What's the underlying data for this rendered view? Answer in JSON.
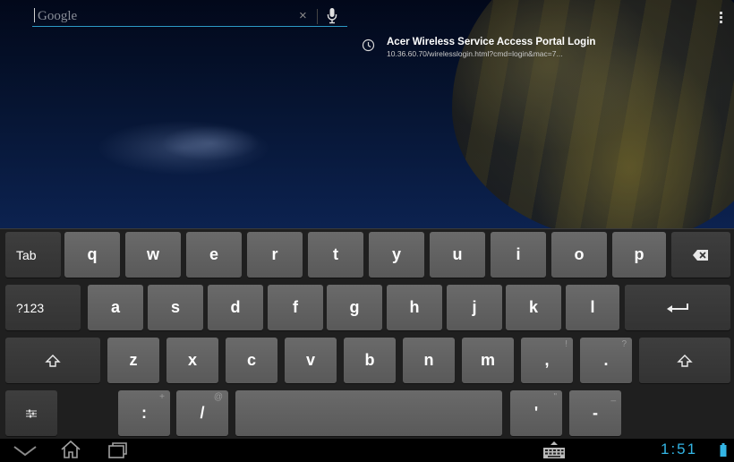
{
  "search": {
    "placeholder": "Google",
    "clear_icon": "×",
    "mic_icon": "microphone-icon"
  },
  "suggestion": {
    "icon": "history-clock-icon",
    "title": "Acer Wireless Service Access Portal Login",
    "url": "10.36.60.70/wirelesslogin.html?cmd=login&mac=7..."
  },
  "keyboard": {
    "row1": {
      "tab": "Tab",
      "keys": [
        "q",
        "w",
        "e",
        "r",
        "t",
        "y",
        "u",
        "i",
        "o",
        "p"
      ],
      "backspace_icon": "backspace-icon"
    },
    "row2": {
      "symbols": "?123",
      "keys": [
        "a",
        "s",
        "d",
        "f",
        "g",
        "h",
        "j",
        "k",
        "l"
      ],
      "enter_icon": "enter-arrow-icon"
    },
    "row3": {
      "shift_icon": "shift-icon",
      "keys": [
        "z",
        "x",
        "c",
        "v",
        "b",
        "n",
        "m"
      ],
      "comma": ",",
      "comma_hint": "!",
      "period": ".",
      "period_hint": "?"
    },
    "row4": {
      "settings_icon": "keyboard-settings-icon",
      "colon": ":",
      "colon_hint": "+",
      "slash": "/",
      "slash_hint": "@",
      "apostrophe": "'",
      "apostrophe_hint": "\"",
      "dash": "-",
      "dash_hint": "_"
    }
  },
  "navbar": {
    "time": "1:51",
    "accent": "#33b5e5"
  }
}
